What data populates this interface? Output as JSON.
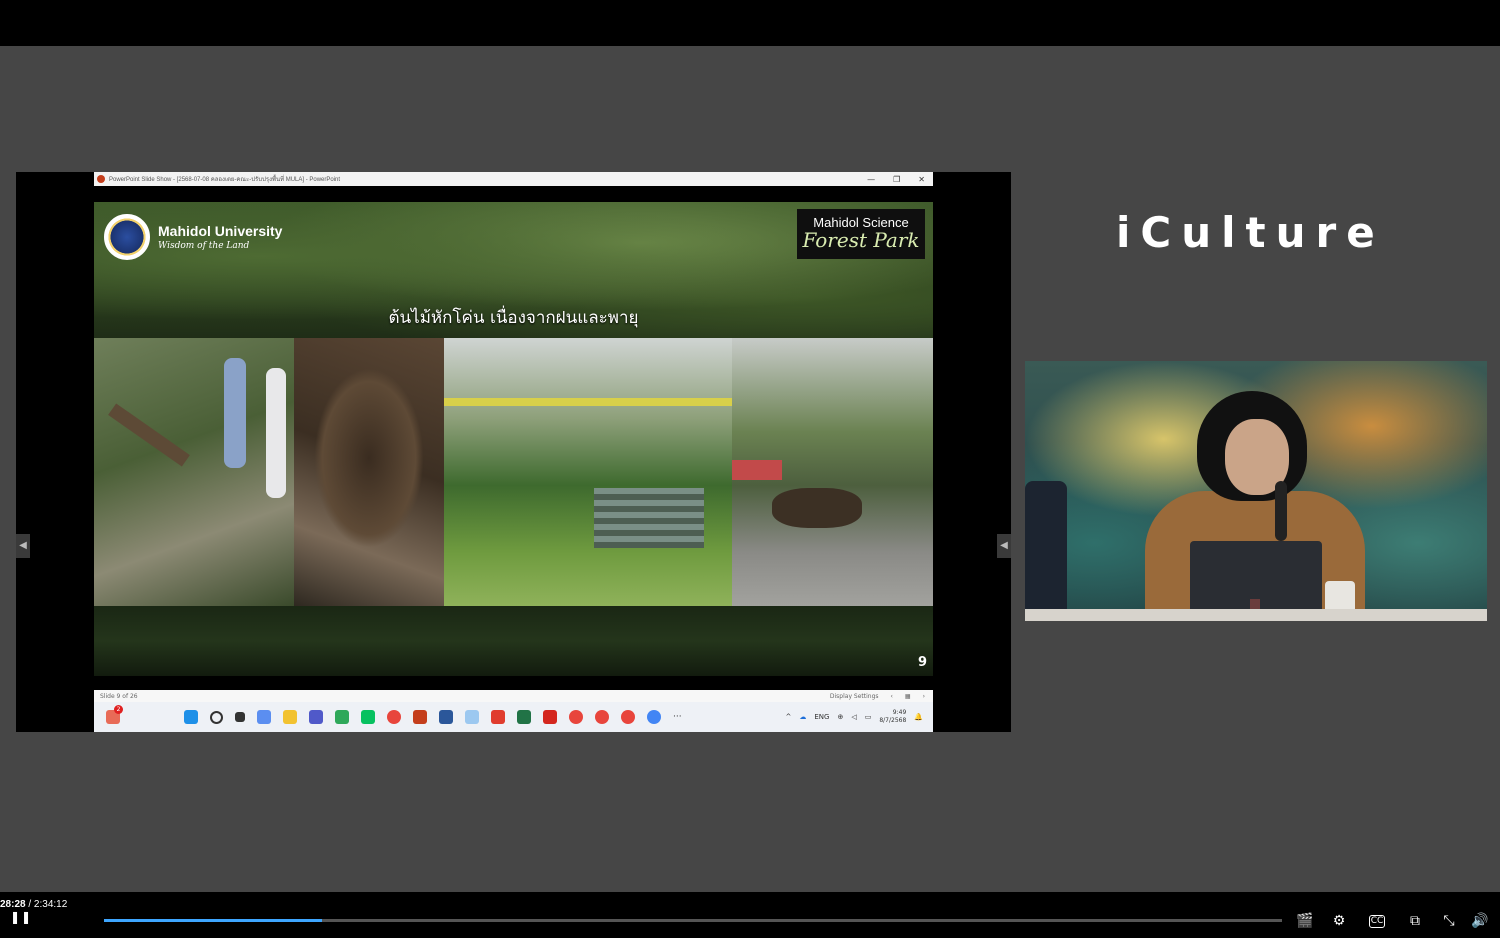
{
  "window": {
    "title": "PowerPoint Slide Show - [2568-07-08 คลองเตย-คณะ-ปรับปรุงพื้นที่ MULA] - PowerPoint",
    "minimize": "—",
    "restore": "❐",
    "close": "✕"
  },
  "slide": {
    "university_name": "Mahidol University",
    "university_motto": "Wisdom of the Land",
    "park_line1": "Mahidol Science",
    "park_line2": "Forest Park",
    "heading": "ต้นไม้หักโค่น เนื่องจากฝนและพายุ",
    "number": "9"
  },
  "ppt_status": {
    "slide_indicator": "Slide 9 of 26",
    "display_settings": "Display Settings"
  },
  "taskbar": {
    "language": "ENG",
    "time": "9:49",
    "date": "8/7/2568",
    "notification_count": "2",
    "overflow": "···"
  },
  "brand": {
    "name": "iCulture"
  },
  "player": {
    "current_time": "28:28",
    "separator": " / ",
    "duration": "2:34:12",
    "progress_fraction": 0.1848,
    "accent_color": "#3ea6ff"
  }
}
